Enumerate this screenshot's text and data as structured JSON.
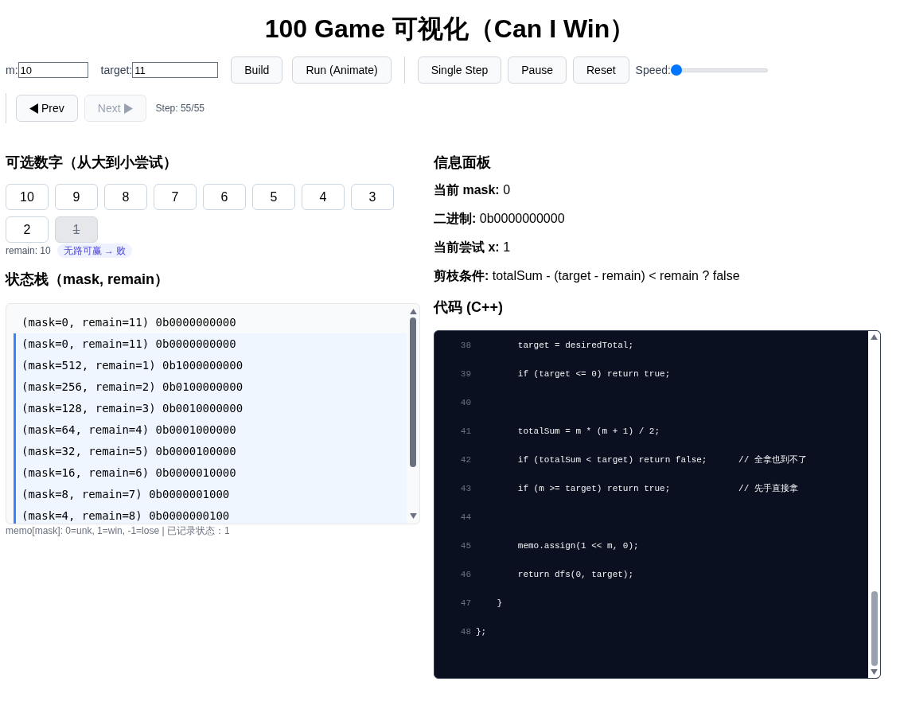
{
  "title": "100 Game 可视化（Can I Win）",
  "controls": {
    "m_label": "m:",
    "m_value": "10",
    "target_label": "target:",
    "target_value": "11",
    "buttons": [
      {
        "label": "Build",
        "disabled": false
      },
      {
        "label": "Run (Animate)",
        "disabled": false
      }
    ],
    "step_buttons": [
      {
        "label": "Single Step",
        "disabled": false
      },
      {
        "label": "Pause",
        "disabled": false
      },
      {
        "label": "Reset",
        "disabled": false
      }
    ],
    "speed_label": "Speed:",
    "speed": {
      "level": 0.0
    },
    "prev": {
      "label": "Prev",
      "disabled": false
    },
    "next": {
      "label": "Next",
      "disabled": true
    },
    "step": "Step: 55/55"
  },
  "numbers": {
    "heading": "可选数字（从大到小尝试）",
    "items": [
      {
        "label": "10",
        "used": false
      },
      {
        "label": "9",
        "used": false
      },
      {
        "label": "8",
        "used": false
      },
      {
        "label": "7",
        "used": false
      },
      {
        "label": "6",
        "used": false
      },
      {
        "label": "5",
        "used": false
      },
      {
        "label": "4",
        "used": false
      },
      {
        "label": "3",
        "used": false
      },
      {
        "label": "2",
        "used": false
      },
      {
        "label": "1",
        "used": true
      }
    ],
    "remain": "remain: 10",
    "badge": "无路可赢 → 败"
  },
  "stack": {
    "heading": "状态栈（mask, remain）",
    "rows": [
      {
        "text": "(mask=0, remain=11) 0b0000000000",
        "active": false
      },
      {
        "text": "(mask=0, remain=11) 0b0000000000",
        "active": true
      },
      {
        "text": "(mask=512, remain=1) 0b1000000000",
        "active": true
      },
      {
        "text": "(mask=256, remain=2) 0b0100000000",
        "active": true
      },
      {
        "text": "(mask=128, remain=3) 0b0010000000",
        "active": true
      },
      {
        "text": "(mask=64, remain=4) 0b0001000000",
        "active": true
      },
      {
        "text": "(mask=32, remain=5) 0b0000100000",
        "active": true
      },
      {
        "text": "(mask=16, remain=6) 0b0000010000",
        "active": true
      },
      {
        "text": "(mask=8, remain=7) 0b0000001000",
        "active": true
      },
      {
        "text": "(mask=4, remain=8) 0b0000000100",
        "active": true
      }
    ],
    "memo": "memo[mask]: 0=unk, 1=win, -1=lose | 已记录状态：1"
  },
  "info": {
    "heading": "信息面板",
    "fields": [
      {
        "label": "当前 mask:",
        "value": "0"
      },
      {
        "label": "二进制:",
        "value": "0b0000000000"
      },
      {
        "label": "当前尝试 x:",
        "value": "1"
      },
      {
        "label": "剪枝条件:",
        "value": "totalSum - (target - remain) < remain ? false"
      }
    ]
  },
  "code": {
    "heading": "代码 (C++)",
    "lines": [
      {
        "number": "38",
        "text": "        target = desiredTotal;"
      },
      {
        "number": "39",
        "text": "        if (target <= 0) return true;"
      },
      {
        "number": "40"
      },
      {
        "number": "41",
        "text": "        totalSum = m * (m + 1) / 2;"
      },
      {
        "number": "42",
        "text": "        if (totalSum < target) return false;      // 全拿也到不了"
      },
      {
        "number": "43",
        "text": "        if (m >= target) return true;             // 先手直接拿"
      },
      {
        "number": "44"
      },
      {
        "number": "45",
        "text": "        memo.assign(1 << m, 0);"
      },
      {
        "number": "46",
        "text": "        return dfs(0, target);"
      },
      {
        "number": "47",
        "text": "    }"
      },
      {
        "number": "48",
        "text": "};"
      }
    ]
  }
}
